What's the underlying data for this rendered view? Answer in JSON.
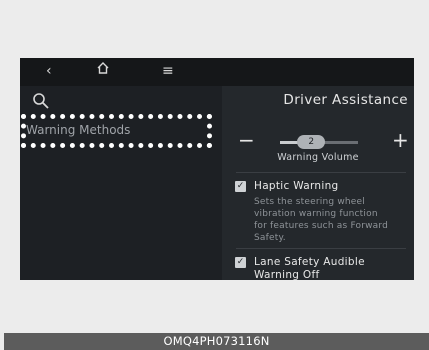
{
  "topbar": {
    "back_icon": "chevron-left-icon",
    "home_icon": "home-icon",
    "menu_icon": "menu-icon"
  },
  "sidebar": {
    "search_icon": "search-icon",
    "items": [
      {
        "label": "Warning Methods",
        "selected": true
      }
    ]
  },
  "main": {
    "title": "Driver Assistance",
    "volume": {
      "label": "Warning Volume",
      "value": "2",
      "level": 0.4,
      "minus_label": "−",
      "plus_label": "+"
    },
    "options": [
      {
        "label": "Haptic Warning",
        "checked": true,
        "description_lines": [
          "Sets the steering wheel",
          "vibration warning function",
          "for features such as Forward",
          "Safety."
        ]
      },
      {
        "label_lines": [
          "Lane Safety Audible",
          "Warning Off"
        ],
        "checked": true
      }
    ]
  },
  "caption": "OMQ4PH073116N",
  "colors": {
    "screen_bg": "#1d2024",
    "panel_bg": "#24282c",
    "highlight_border": "#ffffff",
    "caption_bg": "#5c5c5c"
  }
}
